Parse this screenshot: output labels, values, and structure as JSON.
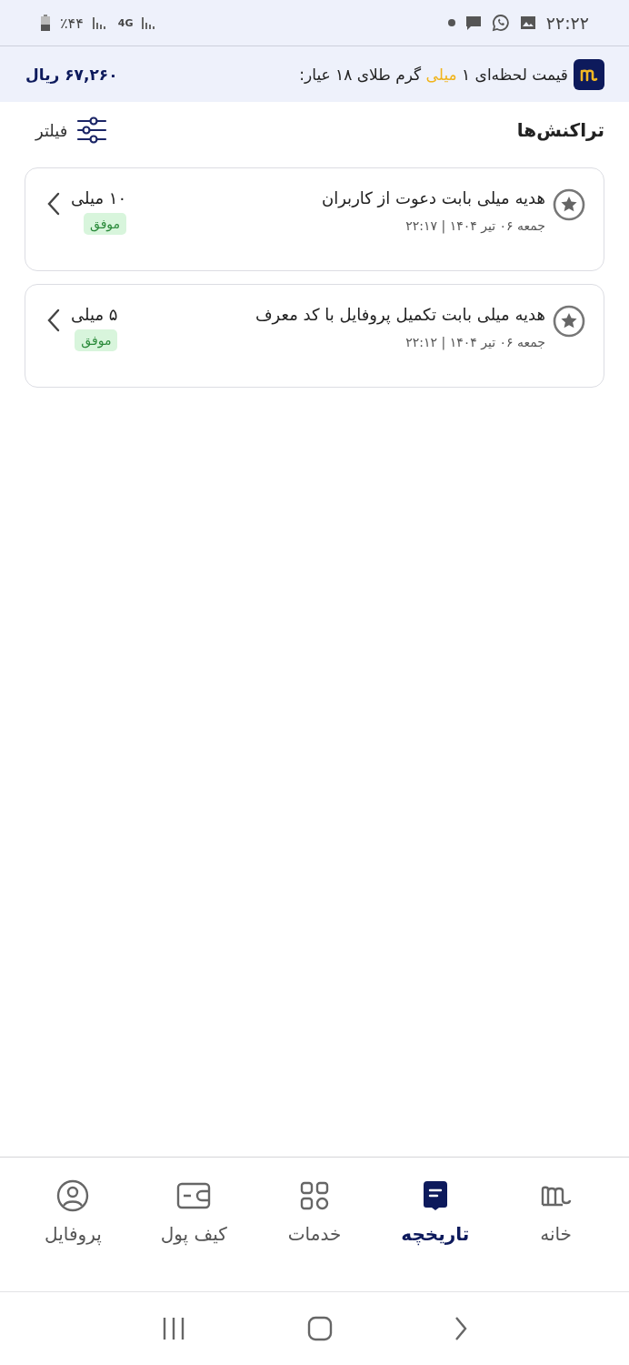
{
  "status_bar": {
    "time": "۲۲:۲۲",
    "network": "4G",
    "battery_text": "٪۴۴"
  },
  "price_banner": {
    "before": "قیمت لحظه‌ای ۱ ",
    "highlight": "میلی",
    "after": " گرم طلای ۱۸ عیار:",
    "price": "۶۷,۲۶۰ ریال"
  },
  "header": {
    "title": "تراکنش‌ها",
    "filter": "فیلتر"
  },
  "transactions": [
    {
      "title": "هدیه میلی بابت دعوت از کاربران",
      "date": "جمعه ۰۶ تیر ۱۴۰۴ | ۲۲:۱۷",
      "amount": "۱۰ میلی",
      "status": "موفق"
    },
    {
      "title": "هدیه میلی بابت تکمیل پروفایل با کد معرف",
      "date": "جمعه ۰۶ تیر ۱۴۰۴ | ۲۲:۱۲",
      "amount": "۵ میلی",
      "status": "موفق"
    }
  ],
  "tabs": [
    {
      "label": "خانه",
      "kind": "home",
      "selected": false
    },
    {
      "label": "تاریخچه",
      "kind": "history",
      "selected": true
    },
    {
      "label": "خدمات",
      "kind": "services",
      "selected": false
    },
    {
      "label": "کیف پول",
      "kind": "wallet",
      "selected": false
    },
    {
      "label": "پروفایل",
      "kind": "profile",
      "selected": false
    }
  ]
}
